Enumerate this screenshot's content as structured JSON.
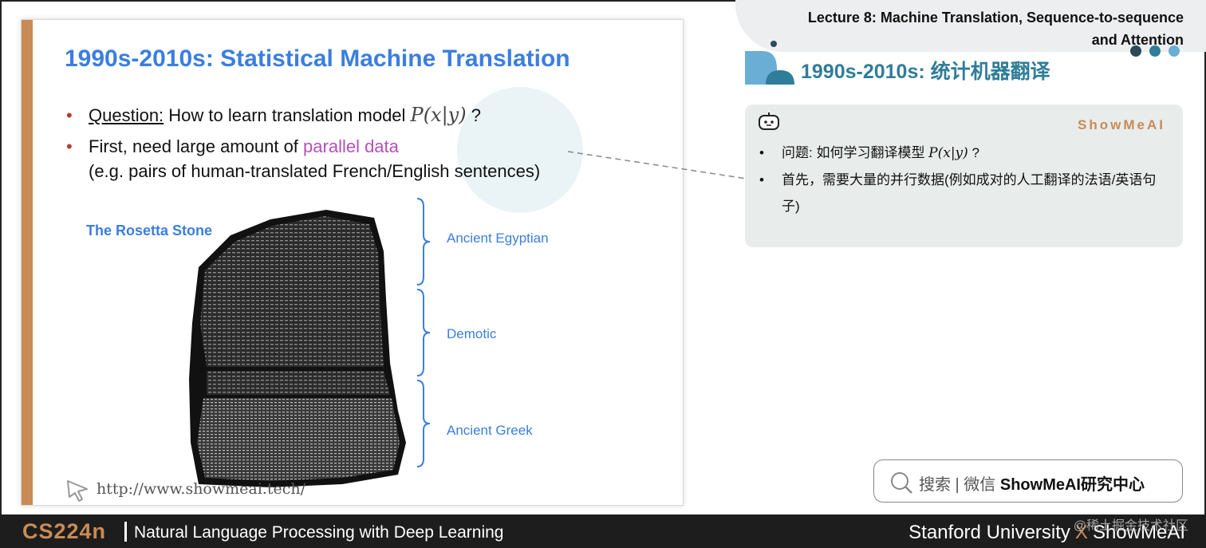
{
  "slide": {
    "title": "1990s-2010s: Statistical Machine Translation",
    "bullet1": {
      "label": "Question:",
      "text": " How to learn translation model ",
      "math": "P(x|y)",
      "tail": " ?"
    },
    "bullet2": {
      "text": "First, need large amount of ",
      "highlight": "parallel data",
      "line2": "(e.g. pairs of human-translated French/English sentences)"
    },
    "rosetta_label": "The Rosetta Stone",
    "sections": [
      "Ancient Egyptian",
      "Demotic",
      "Ancient Greek"
    ],
    "url": "http://www.showmeai.tech/"
  },
  "header": {
    "lecture_line1": "Lecture 8: Machine Translation, Sequence-to-sequence",
    "lecture_line2": "and Attention",
    "dot_colors": [
      "#2a4a5a",
      "#2f7d98",
      "#6aaed6"
    ]
  },
  "cn": {
    "title": "1990s-2010s: 统计机器翻译"
  },
  "note": {
    "brand": "ShowMeAI",
    "item1_text": "问题: 如何学习翻译模型 ",
    "item1_math": "P(x|y)",
    "item1_tail": " ?",
    "item2": "首先，需要大量的并行数据(例如成对的人工翻译的法语/英语句子)"
  },
  "search": {
    "label": "搜索 | 微信",
    "brand": "ShowMeAI",
    "suffix": "研究中心"
  },
  "footer": {
    "course_code": "CS224n",
    "course_name": "Natural Language Processing with Deep Learning",
    "left_org": "Stanford University",
    "x": "X",
    "right_org": "ShowMeAI",
    "watermark": "@稀土掘金技术社区"
  },
  "colors": {
    "accent": "#c98b55",
    "blue": "#3a7ee0",
    "teal": "#2f7d98",
    "highlight": "#b44fba"
  }
}
